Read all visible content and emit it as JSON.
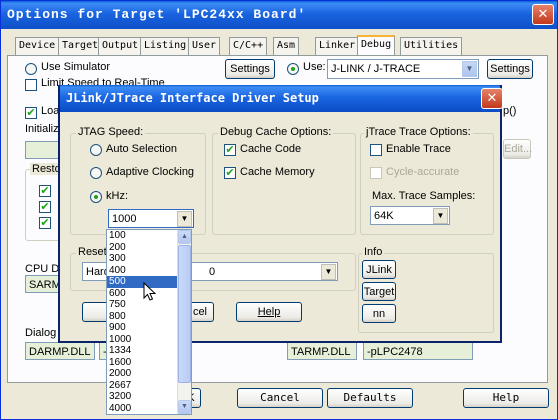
{
  "window": {
    "title": "Options for Target 'LPC24xx Board'",
    "close_glyph": "✕"
  },
  "tabs": [
    {
      "label": "Device"
    },
    {
      "label": "Target"
    },
    {
      "label": "Output"
    },
    {
      "label": "Listing"
    },
    {
      "label": "User"
    },
    {
      "label": "C/C++"
    },
    {
      "label": "Asm"
    },
    {
      "label": "Linker"
    },
    {
      "label": "Debug"
    },
    {
      "label": "Utilities"
    }
  ],
  "left": {
    "use_simulator": "Use Simulator",
    "limit_speed": "Limit Speed to Real-Time",
    "load": "Load",
    "initialization": "Initializ",
    "restore": "Resto",
    "cpu_dll_label": "CPU DLL",
    "cpu_dll_value": "SARM.",
    "dialog_dll_label": "Dialog DLL:",
    "dialog_dll_value": "DARMP.DLL",
    "dialog_param_value": "-p"
  },
  "right": {
    "settings_left": "Settings",
    "use_label": "Use:",
    "driver_value": "J-LINK / J-TRACE",
    "settings_right": "Settings",
    "edit": "Edit...",
    "right_edge_text": "p()",
    "dialog_dll_value": "TARMP.DLL",
    "dialog_param_value": "-pLPC2478"
  },
  "bottom": {
    "cancel": "Cancel",
    "defaults": "Defaults",
    "help": "Help",
    "ok_partial": "K"
  },
  "dialog": {
    "title": "JLink/JTrace Interface Driver Setup",
    "close_glyph": "✕",
    "jtag": {
      "legend": "JTAG Speed:",
      "auto": "Auto Selection",
      "adaptive": "Adaptive Clocking",
      "khz": "kHz:",
      "khz_value": "1000",
      "khz_selected_radio": "kHz"
    },
    "cache": {
      "legend": "Debug Cache Options:",
      "code": "Cache Code",
      "code_checked": true,
      "memory": "Cache Memory",
      "memory_checked": true
    },
    "trace": {
      "legend": "jTrace Trace Options:",
      "enable": "Enable Trace",
      "cycle": "Cycle-accurate",
      "max_label": "Max. Trace Samples:",
      "max_value": "64K"
    },
    "reset": {
      "legend": "Reset",
      "value_left": "Hard",
      "value_right": "0"
    },
    "info": {
      "legend": "Info",
      "jlink": "JLink",
      "target": "Target",
      "nn": "nn"
    },
    "buttons": {
      "cancel_partial": "cel",
      "help": "Help"
    }
  },
  "dropdown_list": {
    "options": [
      "100",
      "200",
      "300",
      "400",
      "500",
      "600",
      "750",
      "800",
      "900",
      "1000",
      "1334",
      "1600",
      "2000",
      "2667",
      "3200",
      "4000"
    ],
    "selected": "500"
  },
  "icons": {
    "combo_arrow": "▼",
    "scroll_up": "▲",
    "scroll_down": "▼",
    "checkmark": "✔"
  }
}
